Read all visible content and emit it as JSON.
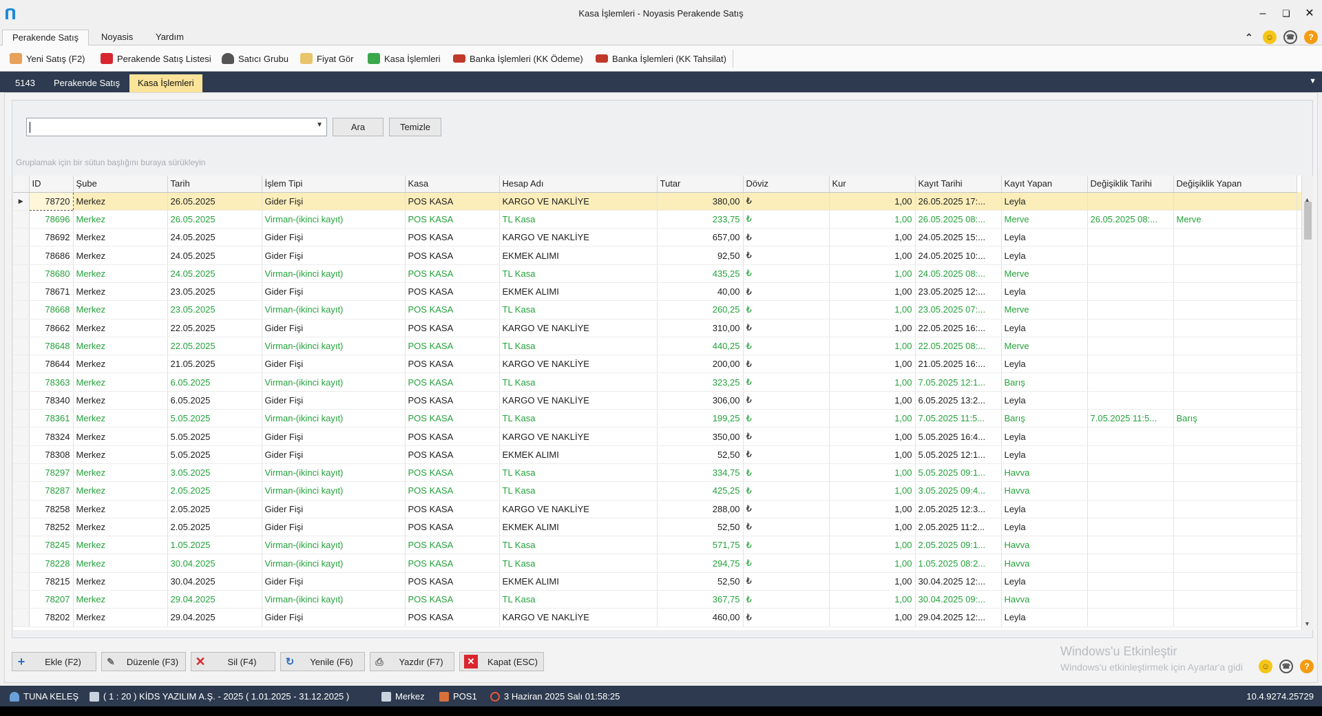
{
  "window": {
    "title": "Kasa İşlemleri - Noyasis Perakende Satış"
  },
  "menu": {
    "tabs": [
      "Perakende Satış",
      "Noyasis",
      "Yardım"
    ]
  },
  "toolbar": {
    "items": [
      "Yeni Satış (F2)",
      "Perakende Satış Listesi",
      "Satıcı Grubu",
      "Fiyat Gör",
      "Kasa İşlemleri",
      "Banka İşlemleri (KK Ödeme)",
      "Banka İşlemleri (KK Tahsilat)"
    ]
  },
  "doc_tabs": [
    "5143",
    "Perakende Satış",
    "Kasa İşlemleri"
  ],
  "search": {
    "value": "",
    "search_label": "Ara",
    "clear_label": "Temizle"
  },
  "group_hint": "Gruplamak için bir sütun başlığını buraya sürükleyin",
  "grid": {
    "columns": [
      "ID",
      "Şube",
      "Tarih",
      "İşlem Tipi",
      "Kasa",
      "Hesap Adı",
      "Tutar",
      "Döviz",
      "Kur",
      "Kayıt Tarihi",
      "Kayıt Yapan",
      "Değişiklik Tarihi",
      "Değişiklik Yapan"
    ],
    "rows": [
      [
        "78720",
        "Merkez",
        "26.05.2025",
        "Gider Fişi",
        "POS KASA",
        "KARGO VE NAKLİYE",
        "380,00",
        "₺",
        "1,00",
        "26.05.2025 17:...",
        "Leyla",
        "",
        ""
      ],
      [
        "78696",
        "Merkez",
        "26.05.2025",
        "Virman-(ikinci kayıt)",
        "POS KASA",
        "TL Kasa",
        "233,75",
        "₺",
        "1,00",
        "26.05.2025 08:...",
        "Merve",
        "26.05.2025 08:...",
        "Merve"
      ],
      [
        "78692",
        "Merkez",
        "24.05.2025",
        "Gider Fişi",
        "POS KASA",
        "KARGO VE NAKLİYE",
        "657,00",
        "₺",
        "1,00",
        "24.05.2025 15:...",
        "Leyla",
        "",
        ""
      ],
      [
        "78686",
        "Merkez",
        "24.05.2025",
        "Gider Fişi",
        "POS KASA",
        "EKMEK ALIMI",
        "92,50",
        "₺",
        "1,00",
        "24.05.2025 10:...",
        "Leyla",
        "",
        ""
      ],
      [
        "78680",
        "Merkez",
        "24.05.2025",
        "Virman-(ikinci kayıt)",
        "POS KASA",
        "TL Kasa",
        "435,25",
        "₺",
        "1,00",
        "24.05.2025 08:...",
        "Merve",
        "",
        ""
      ],
      [
        "78671",
        "Merkez",
        "23.05.2025",
        "Gider Fişi",
        "POS KASA",
        "EKMEK ALIMI",
        "40,00",
        "₺",
        "1,00",
        "23.05.2025 12:...",
        "Leyla",
        "",
        ""
      ],
      [
        "78668",
        "Merkez",
        "23.05.2025",
        "Virman-(ikinci kayıt)",
        "POS KASA",
        "TL Kasa",
        "260,25",
        "₺",
        "1,00",
        "23.05.2025 07:...",
        "Merve",
        "",
        ""
      ],
      [
        "78662",
        "Merkez",
        "22.05.2025",
        "Gider Fişi",
        "POS KASA",
        "KARGO VE NAKLİYE",
        "310,00",
        "₺",
        "1,00",
        "22.05.2025 16:...",
        "Leyla",
        "",
        ""
      ],
      [
        "78648",
        "Merkez",
        "22.05.2025",
        "Virman-(ikinci kayıt)",
        "POS KASA",
        "TL Kasa",
        "440,25",
        "₺",
        "1,00",
        "22.05.2025 08:...",
        "Merve",
        "",
        ""
      ],
      [
        "78644",
        "Merkez",
        "21.05.2025",
        "Gider Fişi",
        "POS KASA",
        "KARGO VE NAKLİYE",
        "200,00",
        "₺",
        "1,00",
        "21.05.2025 16:...",
        "Leyla",
        "",
        ""
      ],
      [
        "78363",
        "Merkez",
        "6.05.2025",
        "Virman-(ikinci kayıt)",
        "POS KASA",
        "TL Kasa",
        "323,25",
        "₺",
        "1,00",
        "7.05.2025 12:1...",
        "Barış",
        "",
        ""
      ],
      [
        "78340",
        "Merkez",
        "6.05.2025",
        "Gider Fişi",
        "POS KASA",
        "KARGO VE NAKLİYE",
        "306,00",
        "₺",
        "1,00",
        "6.05.2025 13:2...",
        "Leyla",
        "",
        ""
      ],
      [
        "78361",
        "Merkez",
        "5.05.2025",
        "Virman-(ikinci kayıt)",
        "POS KASA",
        "TL Kasa",
        "199,25",
        "₺",
        "1,00",
        "7.05.2025 11:5...",
        "Barış",
        "7.05.2025 11:5...",
        "Barış"
      ],
      [
        "78324",
        "Merkez",
        "5.05.2025",
        "Gider Fişi",
        "POS KASA",
        "KARGO VE NAKLİYE",
        "350,00",
        "₺",
        "1,00",
        "5.05.2025 16:4...",
        "Leyla",
        "",
        ""
      ],
      [
        "78308",
        "Merkez",
        "5.05.2025",
        "Gider Fişi",
        "POS KASA",
        "EKMEK ALIMI",
        "52,50",
        "₺",
        "1,00",
        "5.05.2025 12:1...",
        "Leyla",
        "",
        ""
      ],
      [
        "78297",
        "Merkez",
        "3.05.2025",
        "Virman-(ikinci kayıt)",
        "POS KASA",
        "TL Kasa",
        "334,75",
        "₺",
        "1,00",
        "5.05.2025 09:1...",
        "Havva",
        "",
        ""
      ],
      [
        "78287",
        "Merkez",
        "2.05.2025",
        "Virman-(ikinci kayıt)",
        "POS KASA",
        "TL Kasa",
        "425,25",
        "₺",
        "1,00",
        "3.05.2025 09:4...",
        "Havva",
        "",
        ""
      ],
      [
        "78258",
        "Merkez",
        "2.05.2025",
        "Gider Fişi",
        "POS KASA",
        "KARGO VE NAKLİYE",
        "288,00",
        "₺",
        "1,00",
        "2.05.2025 12:3...",
        "Leyla",
        "",
        ""
      ],
      [
        "78252",
        "Merkez",
        "2.05.2025",
        "Gider Fişi",
        "POS KASA",
        "EKMEK ALIMI",
        "52,50",
        "₺",
        "1,00",
        "2.05.2025 11:2...",
        "Leyla",
        "",
        ""
      ],
      [
        "78245",
        "Merkez",
        "1.05.2025",
        "Virman-(ikinci kayıt)",
        "POS KASA",
        "TL Kasa",
        "571,75",
        "₺",
        "1,00",
        "2.05.2025 09:1...",
        "Havva",
        "",
        ""
      ],
      [
        "78228",
        "Merkez",
        "30.04.2025",
        "Virman-(ikinci kayıt)",
        "POS KASA",
        "TL Kasa",
        "294,75",
        "₺",
        "1,00",
        "1.05.2025 08:2...",
        "Havva",
        "",
        ""
      ],
      [
        "78215",
        "Merkez",
        "30.04.2025",
        "Gider Fişi",
        "POS KASA",
        "EKMEK ALIMI",
        "52,50",
        "₺",
        "1,00",
        "30.04.2025 12:...",
        "Leyla",
        "",
        ""
      ],
      [
        "78207",
        "Merkez",
        "29.04.2025",
        "Virman-(ikinci kayıt)",
        "POS KASA",
        "TL Kasa",
        "367,75",
        "₺",
        "1,00",
        "30.04.2025 09:...",
        "Havva",
        "",
        ""
      ],
      [
        "78202",
        "Merkez",
        "29.04.2025",
        "Gider Fişi",
        "POS KASA",
        "KARGO VE NAKLİYE",
        "460,00",
        "₺",
        "1,00",
        "29.04.2025 12:...",
        "Leyla",
        "",
        ""
      ]
    ]
  },
  "buttons": {
    "add": "Ekle (F2)",
    "edit": "Düzenle (F3)",
    "delete": "Sil (F4)",
    "refresh": "Yenile (F6)",
    "print": "Yazdır (F7)",
    "close": "Kapat (ESC)"
  },
  "watermark": {
    "line1": "Windows'u Etkinleştir",
    "line2": "Windows'u etkinleştirmek için Ayarlar'a gidi"
  },
  "status": {
    "user": "TUNA KELEŞ",
    "company": "( 1 : 20 )  KİDS YAZILIM A.Ş. - 2025  ( 1.01.2025 - 31.12.2025 )",
    "branch": "Merkez",
    "pos": "POS1",
    "datetime": "3 Haziran 2025 Salı 01:58:25",
    "version": "10.4.9274.25729"
  },
  "colors": {
    "green_row": "#23a23a",
    "selected_row": "#fbeebb",
    "nav_dark": "#2d3a4f",
    "active_tab": "#fbe49a"
  }
}
